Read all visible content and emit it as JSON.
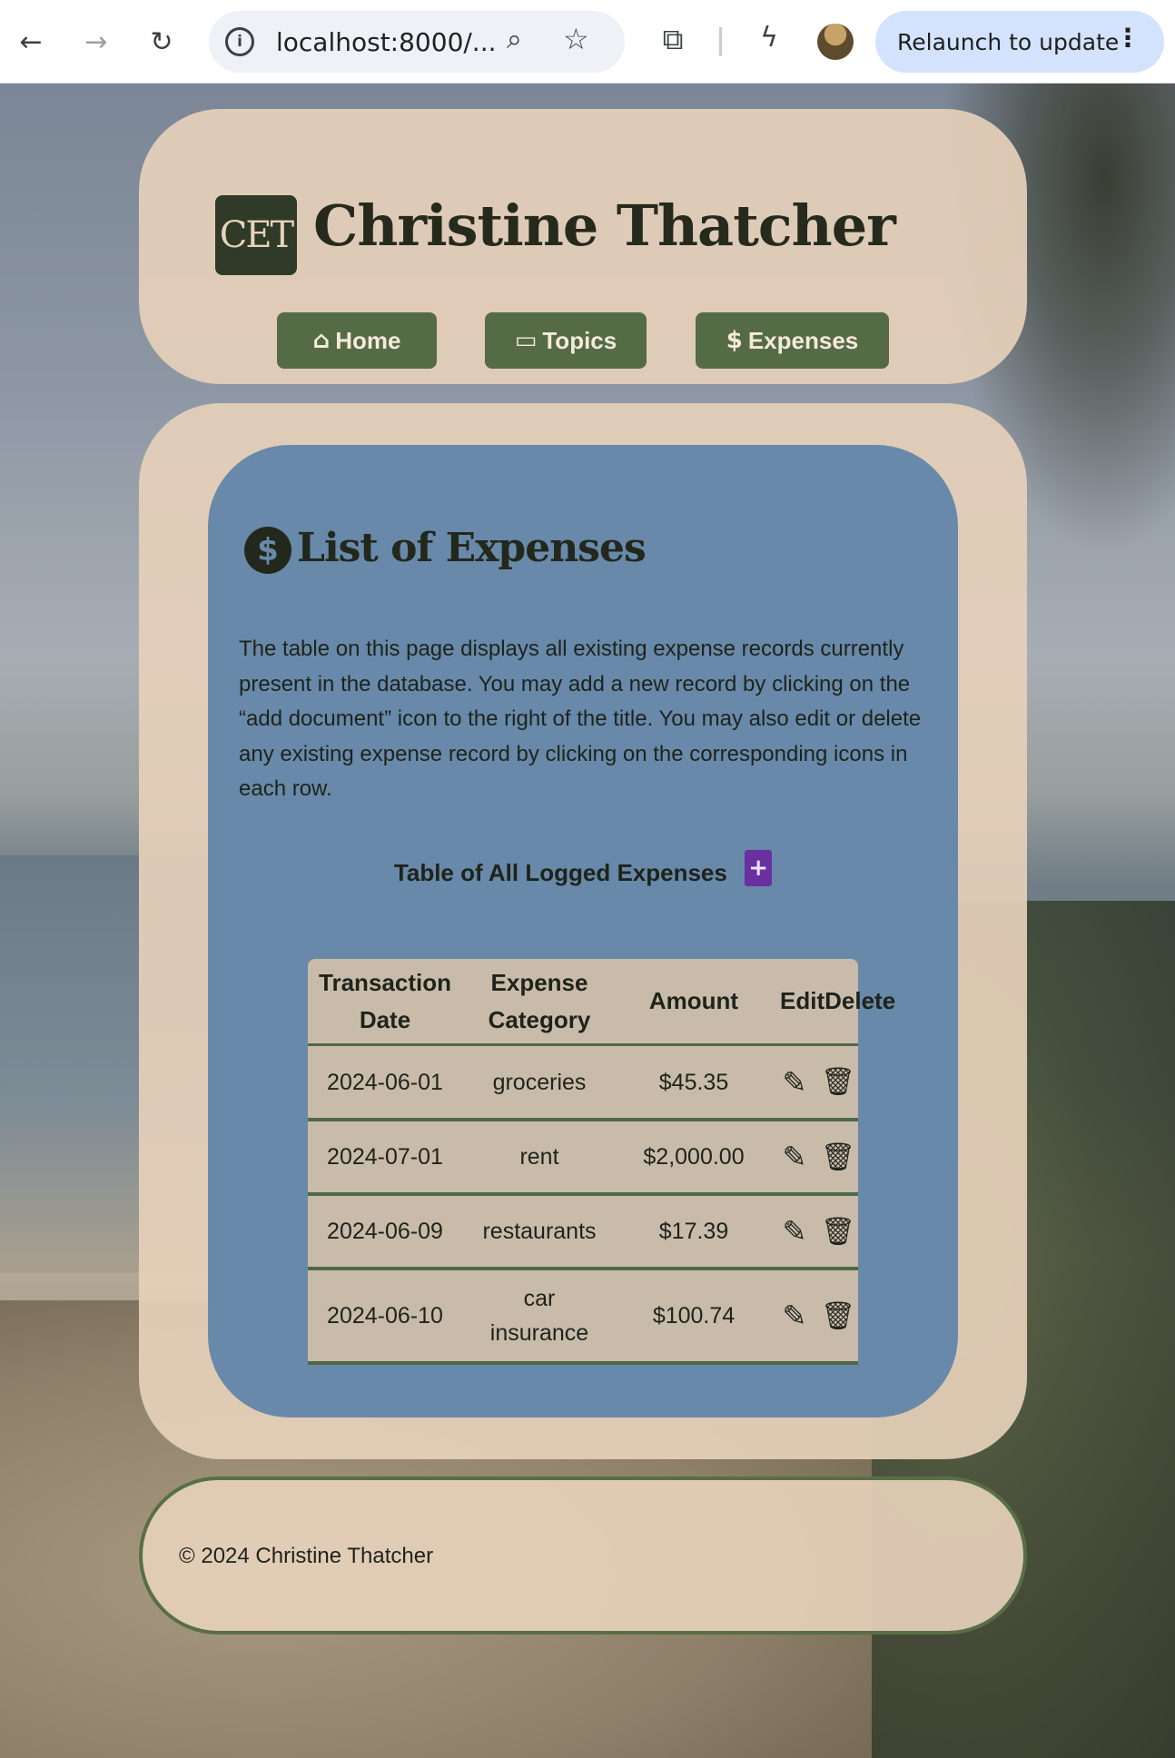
{
  "browser": {
    "url": "localhost:8000/...",
    "relaunch_label": "Relaunch to update"
  },
  "header": {
    "logo_text": "CET",
    "site_title": "Christine Thatcher",
    "nav": [
      {
        "label": "Home",
        "icon": "home-icon"
      },
      {
        "label": "Topics",
        "icon": "monitor-icon"
      },
      {
        "label": "Expenses",
        "icon": "dollar-circle-icon"
      }
    ]
  },
  "main": {
    "title": "List of Expenses",
    "intro": "The table on this page displays all existing expense records currently present in the database. You may add a new record by clicking on the “add document” icon to the right of the title. You may also edit or delete any existing expense record by clicking on the corresponding icons in each row.",
    "table_caption": "Table of All Logged Expenses",
    "columns": {
      "date": "Transaction Date",
      "category": "Expense Category",
      "amount": "Amount",
      "edit": "Edit",
      "delete": "Delete"
    },
    "rows": [
      {
        "date": "2024-06-01",
        "category": "groceries",
        "amount": "$45.35"
      },
      {
        "date": "2024-07-01",
        "category": "rent",
        "amount": "$2,000.00"
      },
      {
        "date": "2024-06-09",
        "category": "restaurants",
        "amount": "$17.39"
      },
      {
        "date": "2024-06-10",
        "category": "car insurance",
        "amount": "$100.74"
      }
    ]
  },
  "footer": {
    "copyright": "© 2024 Christine Thatcher"
  },
  "colors": {
    "panel": "#e5d0b9",
    "nav_button": "#556b45",
    "card": "#6889a9",
    "table": "#c9bba9",
    "add_icon": "#6a2fa0"
  }
}
